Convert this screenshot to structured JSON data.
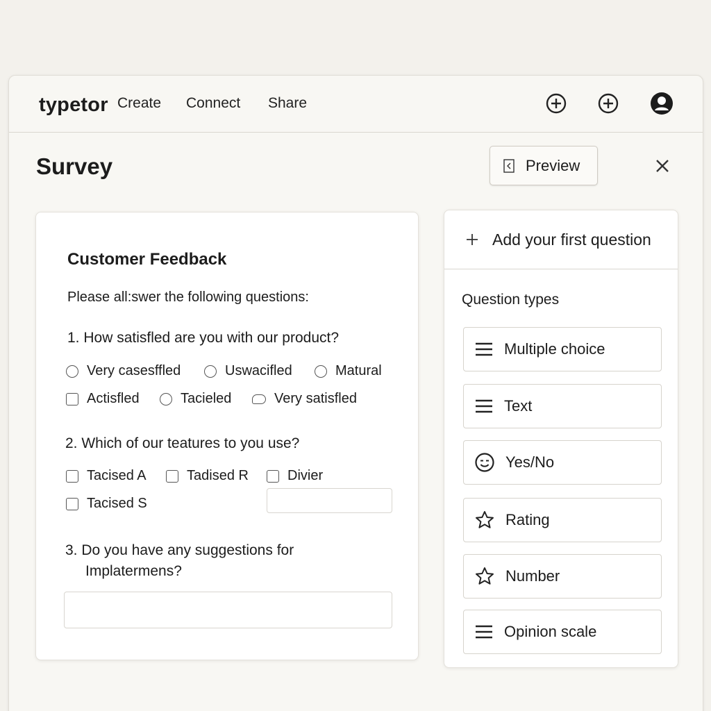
{
  "app": {
    "logo": "typetor",
    "nav": [
      "Create",
      "Connect",
      "Share"
    ],
    "icons": [
      "plus-circle-icon",
      "plus-circle-icon",
      "user-avatar-icon"
    ]
  },
  "page": {
    "title": "Survey",
    "preview_label": "Preview"
  },
  "form": {
    "title": "Customer Feedback",
    "intro": "Please all:swer the following questions:",
    "q1": {
      "label": "1.  How satisfled are you with our product?",
      "options": [
        {
          "label": "Very casesffled",
          "control": "radio"
        },
        {
          "label": "Uswacifled",
          "control": "radio"
        },
        {
          "label": "Matural",
          "control": "radio"
        },
        {
          "label": "Actisfled",
          "control": "checkbox"
        },
        {
          "label": "Tacieled",
          "control": "radio"
        },
        {
          "label": "Very satisfled",
          "control": "pill"
        }
      ]
    },
    "q2": {
      "label": "2. Which of our teatures to you use?",
      "options": [
        "Tacised A",
        "Tadised R",
        "Divier",
        "Tacised S"
      ]
    },
    "q3": {
      "line1": "3.  Do you have any suggestions for",
      "line2": "Implatermens?",
      "answer": ""
    }
  },
  "sidebar": {
    "add_label": "Add your first question",
    "types_heading": "Question types",
    "types": [
      {
        "label": "Multiple choice",
        "icon": "list-icon"
      },
      {
        "label": "Text",
        "icon": "list-icon"
      },
      {
        "label": "Yes/No",
        "icon": "smiley-icon"
      },
      {
        "label": "Rating",
        "icon": "star-icon"
      },
      {
        "label": "Number",
        "icon": "star-icon"
      },
      {
        "label": "Opinion scale",
        "icon": "list-icon"
      }
    ]
  }
}
